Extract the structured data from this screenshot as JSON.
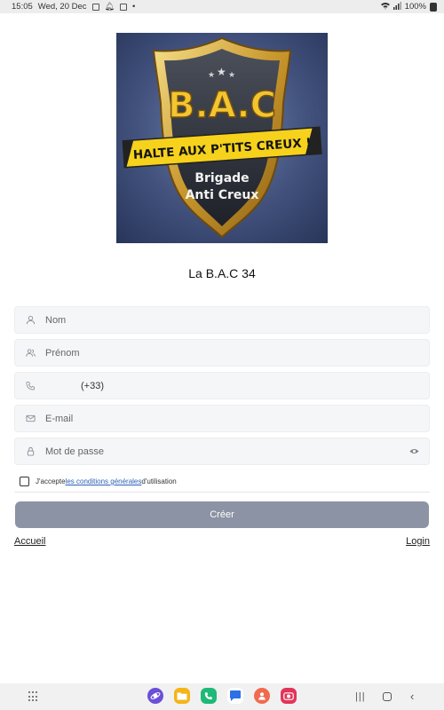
{
  "status_bar": {
    "time": "15:05",
    "date": "Wed, 20 Dec",
    "dot": "•",
    "battery": "100%"
  },
  "logo": {
    "acronym": "B.A.C",
    "banner": "HALTE AUX P'TITS CREUX !",
    "line1": "Brigade",
    "line2": "Anti Creux"
  },
  "title": "La B.A.C 34",
  "form": {
    "nom_placeholder": "Nom",
    "prenom_placeholder": "Prénom",
    "phone_prefix": "(+33)",
    "email_placeholder": "E-mail",
    "password_placeholder": "Mot de passe",
    "terms_prefix": "J'accepte ",
    "terms_link": "les conditions générales",
    "terms_suffix": " d'utilisation",
    "submit_label": "Créer"
  },
  "links": {
    "home": "Accueil",
    "login": "Login"
  },
  "colors": {
    "button": "#8b93a4",
    "link": "#2d5fb8"
  }
}
